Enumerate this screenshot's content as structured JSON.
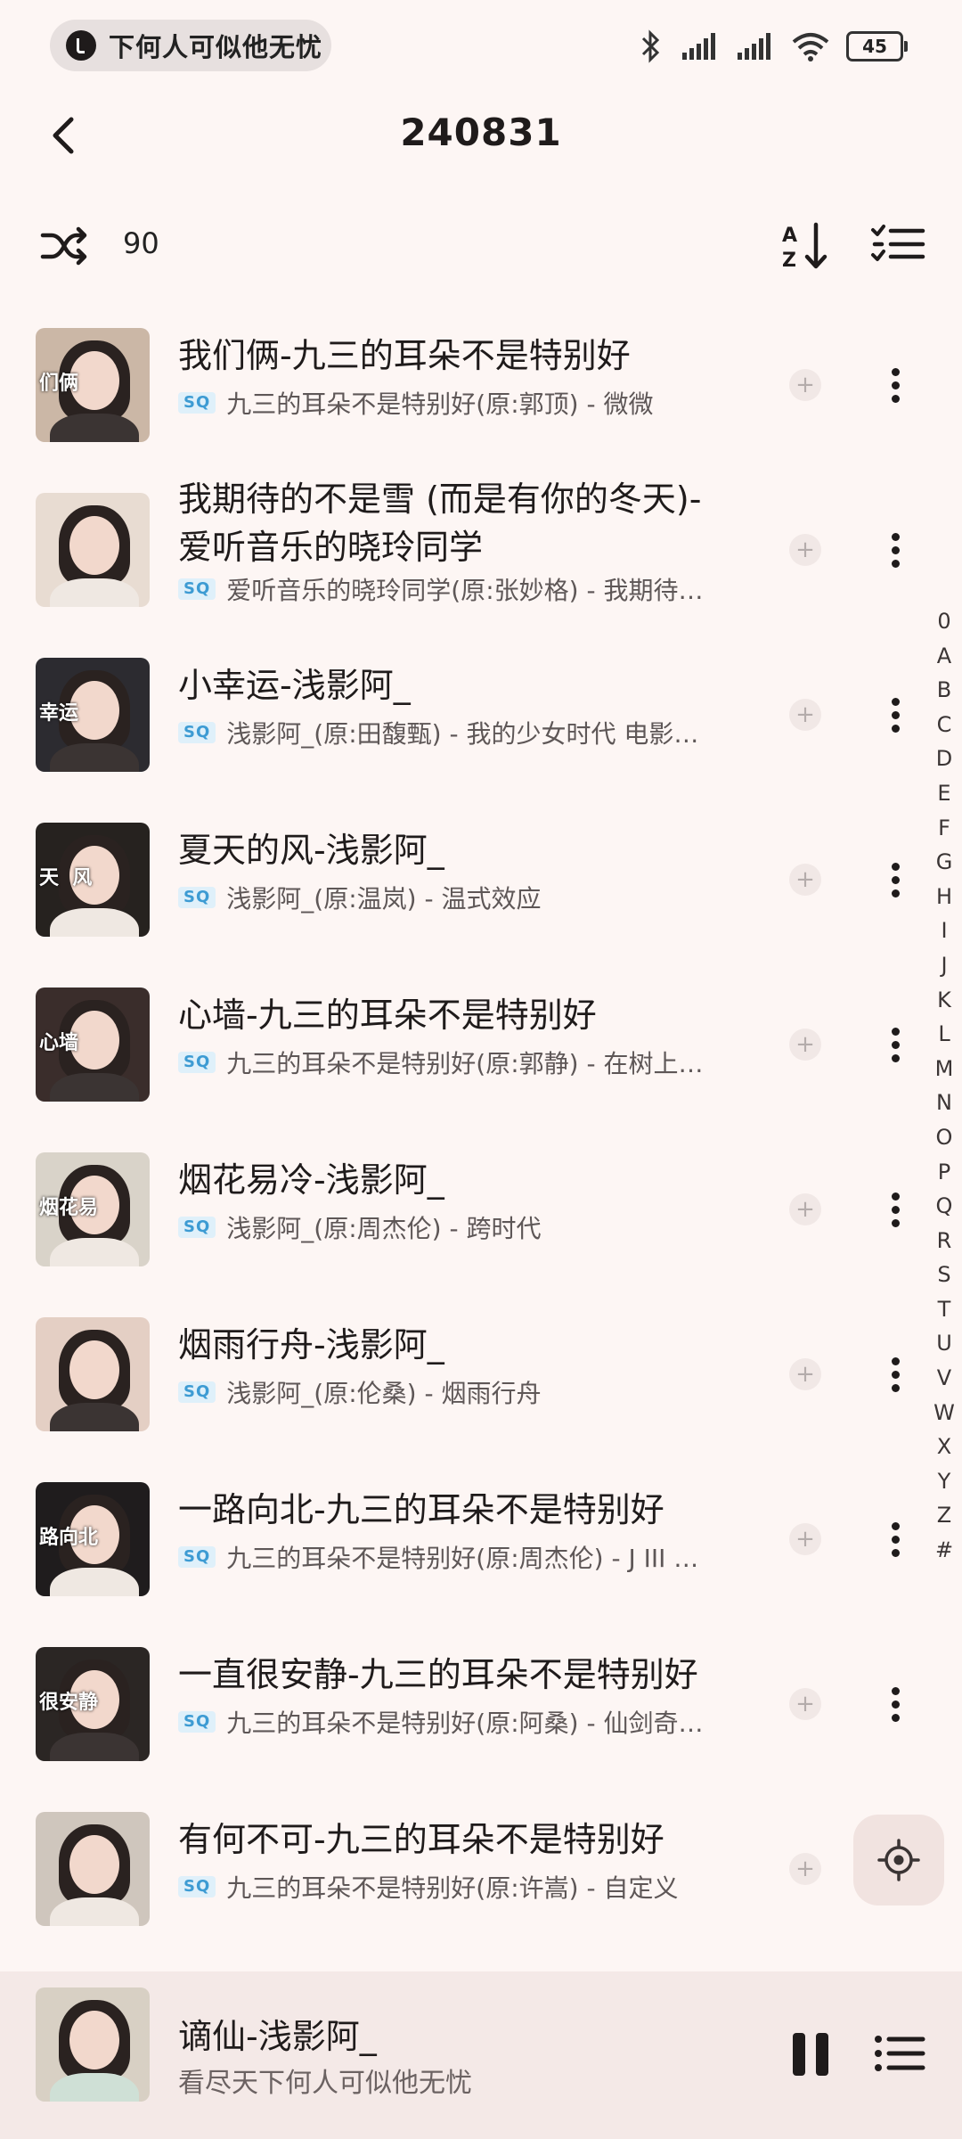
{
  "status_bar": {
    "now_playing": "下何人可似他无忧",
    "battery": "45"
  },
  "header": {
    "title": "240831"
  },
  "toolbar": {
    "song_count": "90"
  },
  "songs": [
    {
      "title": "我们俩-九三的耳朵不是特别好",
      "subtitle": "九三的耳朵不是特别好(原:郭顶) - 微微",
      "badge": "SQ",
      "cover_text": "们俩",
      "cover_color": "#cbb7a6"
    },
    {
      "title": "我期待的不是雪 (而是有你的冬天)-爱听音乐的晓玲同学",
      "subtitle": "爱听音乐的晓玲同学(原:张妙格) - 我期待…",
      "badge": "SQ",
      "cover_text": "",
      "cover_color": "#e8dcd2"
    },
    {
      "title": "小幸运-浅影阿_",
      "subtitle": "浅影阿_(原:田馥甄) - 我的少女时代 电影…",
      "badge": "SQ",
      "cover_text": "幸运",
      "cover_color": "#2c2b30"
    },
    {
      "title": "夏天的风-浅影阿_",
      "subtitle": "浅影阿_(原:温岚) - 温式效应",
      "badge": "SQ",
      "cover_text": "天  风",
      "cover_color": "#26221f"
    },
    {
      "title": "心墙-九三的耳朵不是特别好",
      "subtitle": "九三的耳朵不是特别好(原:郭静) - 在树上…",
      "badge": "SQ",
      "cover_text": "心墙",
      "cover_color": "#3a2d2b"
    },
    {
      "title": "烟花易冷-浅影阿_",
      "subtitle": "浅影阿_(原:周杰伦) - 跨时代",
      "badge": "SQ",
      "cover_text": "烟花易",
      "cover_color": "#d9d3c9"
    },
    {
      "title": "烟雨行舟-浅影阿_",
      "subtitle": "浅影阿_(原:伦桑) - 烟雨行舟",
      "badge": "SQ",
      "cover_text": "",
      "cover_color": "#e4cfc4"
    },
    {
      "title": "一路向北-九三的耳朵不是特别好",
      "subtitle": "九三的耳朵不是特别好(原:周杰伦) - J III …",
      "badge": "SQ",
      "cover_text": "路向北",
      "cover_color": "#1f1c1d"
    },
    {
      "title": "一直很安静-九三的耳朵不是特别好",
      "subtitle": "九三的耳朵不是特别好(原:阿桑) - 仙剑奇…",
      "badge": "SQ",
      "cover_text": "很安静",
      "cover_color": "#2b2624"
    },
    {
      "title": "有何不可-九三的耳朵不是特别好",
      "subtitle": "九三的耳朵不是特别好(原:许嵩) - 自定义",
      "badge": "SQ",
      "cover_text": "",
      "cover_color": "#cfc6bd"
    }
  ],
  "alphabet_index": [
    "0",
    "A",
    "B",
    "C",
    "D",
    "E",
    "F",
    "G",
    "H",
    "I",
    "J",
    "K",
    "L",
    "M",
    "N",
    "O",
    "P",
    "Q",
    "R",
    "S",
    "T",
    "U",
    "V",
    "W",
    "X",
    "Y",
    "Z",
    "#"
  ],
  "mini_player": {
    "title": "谪仙-浅影阿_",
    "subtitle": "看尽天下何人可似他无忧",
    "cover_color": "#d8d0c4"
  }
}
